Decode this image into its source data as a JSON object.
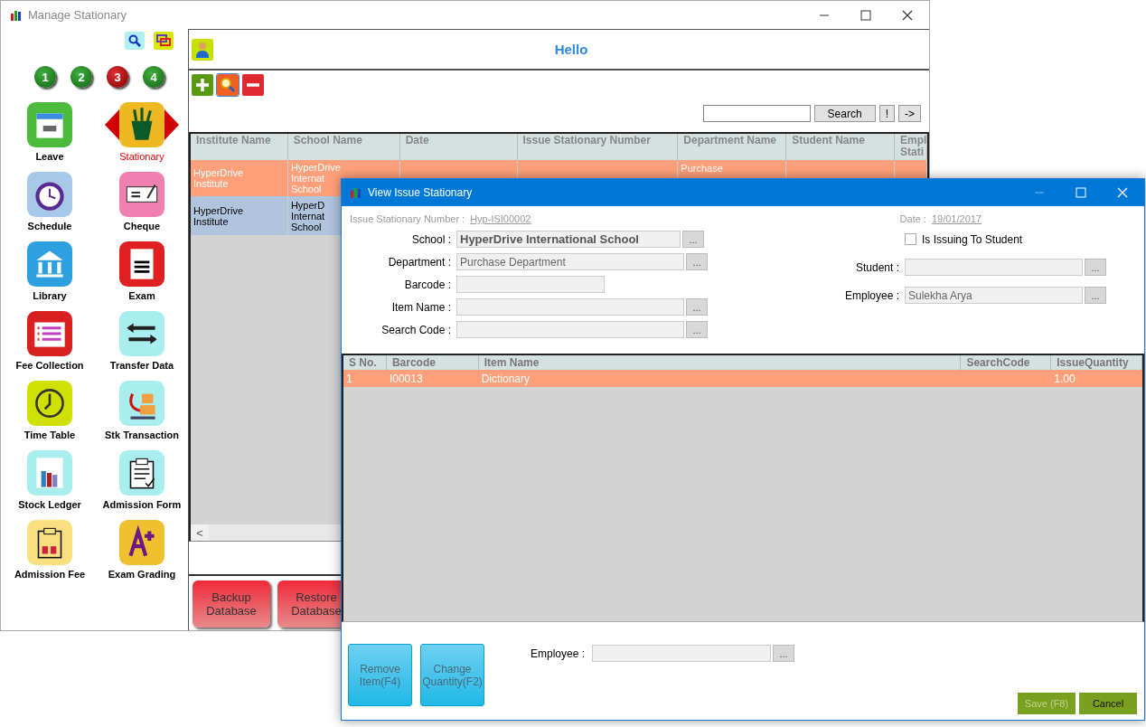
{
  "main_window": {
    "title": "Manage Stationary",
    "numbers": [
      {
        "label": "1",
        "selected": false
      },
      {
        "label": "2",
        "selected": false
      },
      {
        "label": "3",
        "selected": true
      },
      {
        "label": "4",
        "selected": false
      }
    ],
    "modules": [
      {
        "label": "Leave",
        "selected": false
      },
      {
        "label": "Stationary",
        "selected": true
      },
      {
        "label": "Schedule",
        "selected": false
      },
      {
        "label": "Cheque",
        "selected": false
      },
      {
        "label": "Library",
        "selected": false
      },
      {
        "label": "Exam",
        "selected": false
      },
      {
        "label": "Fee Collection",
        "selected": false
      },
      {
        "label": "Transfer Data",
        "selected": false
      },
      {
        "label": "Time Table",
        "selected": false
      },
      {
        "label": "Stk Transaction",
        "selected": false
      },
      {
        "label": "Stock Ledger",
        "selected": false
      },
      {
        "label": "Admission Form",
        "selected": false
      },
      {
        "label": "Admission Fee",
        "selected": false
      },
      {
        "label": "Exam Grading",
        "selected": false
      }
    ],
    "greeting": "Hello",
    "search": {
      "button": "Search",
      "extra_buttons": [
        "!",
        "->"
      ]
    },
    "table": {
      "columns": [
        "Institute Name",
        "School Name",
        "Date",
        "Issue Stationary Number",
        "Department Name",
        "Student Name",
        "Empl Stati"
      ],
      "rows": [
        {
          "selected": true,
          "institute_name": "HyperDrive Institute",
          "school_name": "HyperDrive Internat School",
          "department_name": "Purchase"
        },
        {
          "selected": false,
          "institute_name": "HyperDrive Institute",
          "school_name": "HyperD Internat School"
        }
      ]
    },
    "scroll_left": "<",
    "footer_buttons": [
      "Backup Database",
      "Restore Database"
    ]
  },
  "dialog": {
    "title": "View Issue Stationary",
    "number_label": "Issue Stationary Number :",
    "number": "Hyp-ISI00002",
    "date_label": "Date :",
    "date": "19/01/2017",
    "left_fields": [
      {
        "label": "School :",
        "value": "HyperDrive International School",
        "kind": "bold",
        "browse": "..."
      },
      {
        "label": "Department :",
        "value": "Purchase Department",
        "kind": "text",
        "browse": "..."
      },
      {
        "label": "Barcode :",
        "kind": "short"
      },
      {
        "label": "Item Name :",
        "kind": "text",
        "browse": "..."
      },
      {
        "label": "Search Code :",
        "kind": "text",
        "browse": "..."
      }
    ],
    "issuing_to_student": {
      "label": "Is Issuing To Student",
      "checked": false
    },
    "right_fields": [
      {
        "label": "Student :",
        "browse": "..."
      },
      {
        "label": "Employee :",
        "value": "Sulekha Arya",
        "browse": "..."
      }
    ],
    "grid": {
      "columns": [
        "S No.",
        "Barcode",
        "Item Name",
        "SearchCode",
        "IssueQuantity"
      ],
      "rows": [
        {
          "selected": true,
          "s_no": "1",
          "barcode": "I00013",
          "item_name": "Dictionary",
          "issue_quantity": "1.00"
        }
      ]
    },
    "actions": [
      {
        "label": "Remove Item(F4)",
        "disabled": true
      },
      {
        "label": "Change Quantity(F2)",
        "disabled": true
      }
    ],
    "employee": {
      "label": "Employee :",
      "browse": "..."
    },
    "buttons": [
      {
        "label": "Save (F8)",
        "disabled": true
      },
      {
        "label": "Cancel",
        "disabled": false
      }
    ]
  }
}
